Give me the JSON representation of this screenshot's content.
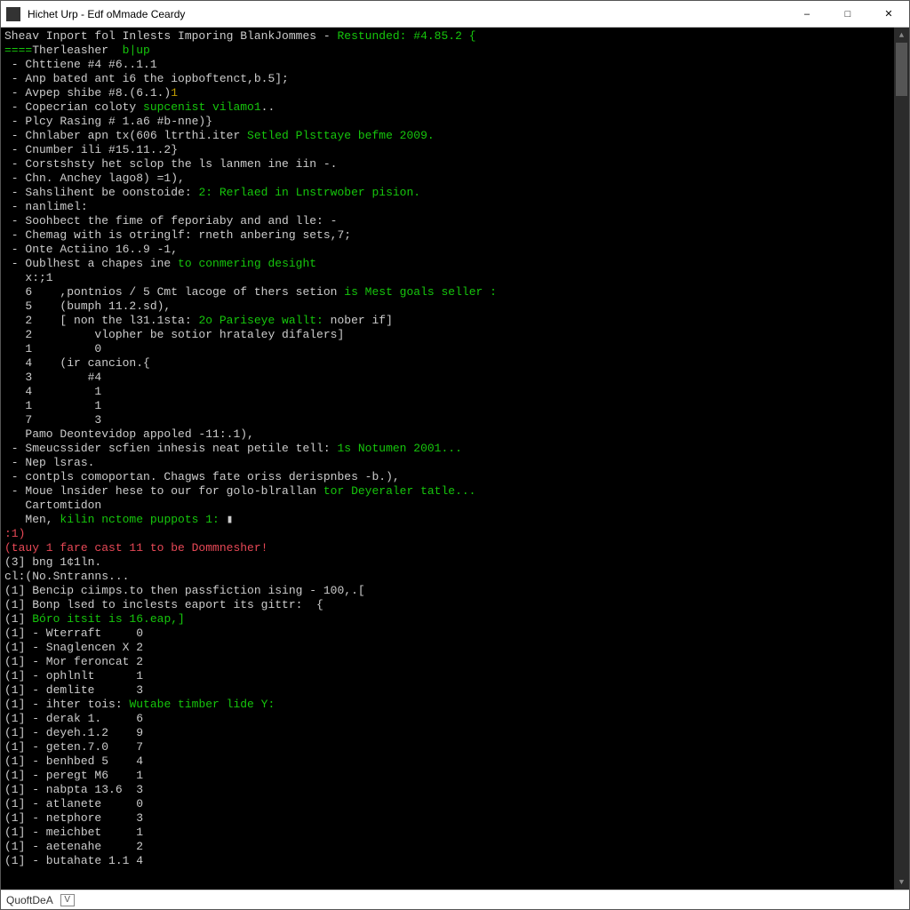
{
  "window": {
    "title": "Hichet Urp - Edf oMmade Ceardy"
  },
  "statusbar": {
    "label": "QuoftDeA",
    "box": "V"
  },
  "lines": [
    [
      {
        "t": "Sheav Inport fol Inlests Imporing BlankJommes - ",
        "c": "w"
      },
      {
        "t": "Restunded: #4.85.2 {",
        "c": "g"
      }
    ],
    [
      {
        "t": "====",
        "c": "g"
      },
      {
        "t": "Therleasher  ",
        "c": "w"
      },
      {
        "t": "b|up",
        "c": "g"
      }
    ],
    [
      {
        "t": " - Chttiene #4 #6..1.1",
        "c": "w"
      }
    ],
    [
      {
        "t": " - Anp bated ant i6 the iopboftenct,b.5];",
        "c": "w"
      }
    ],
    [
      {
        "t": " - Avpep shibe #8.(6.1.)",
        "c": "w"
      },
      {
        "t": "1",
        "c": "y"
      }
    ],
    [
      {
        "t": " - Copecrian coloty ",
        "c": "w"
      },
      {
        "t": "supcenist vilamo1",
        "c": "g"
      },
      {
        "t": "..",
        "c": "w"
      }
    ],
    [
      {
        "t": " - Plcy Rasing # 1.a6 #b-nne)}",
        "c": "w"
      }
    ],
    [
      {
        "t": " - Chnlaber apn tx(606 ltrthi.iter ",
        "c": "w"
      },
      {
        "t": "Setled Plsttaye befme 2009.",
        "c": "g"
      }
    ],
    [
      {
        "t": " - Cnumber ili #15.11..2}",
        "c": "w"
      }
    ],
    [
      {
        "t": " - Corstshsty het sclop the ls lanmen ine iin -.",
        "c": "w"
      }
    ],
    [
      {
        "t": " - Chn. Anchey lago8) =1),",
        "c": "w"
      }
    ],
    [
      {
        "t": " - Sahslihent be oonstoide: ",
        "c": "w"
      },
      {
        "t": "2: Rerlaed in Lnstrwober pision.",
        "c": "g"
      }
    ],
    [
      {
        "t": " - nanlimel:",
        "c": "w"
      }
    ],
    [
      {
        "t": " - Soohbect the fime of feporiaby and and lle: -",
        "c": "w"
      }
    ],
    [
      {
        "t": " - Chemag with is otringlf: rneth anbering sets,7;",
        "c": "w"
      }
    ],
    [
      {
        "t": " - Onte Actiino 16..9 -1,",
        "c": "w"
      }
    ],
    [
      {
        "t": " - Oublhest a chapes ine ",
        "c": "w"
      },
      {
        "t": "to conmering desight",
        "c": "g"
      }
    ],
    [
      {
        "t": "   x:;1",
        "c": "w"
      }
    ],
    [
      {
        "t": "   6    ,pontnios / 5 Cmt lacoge of thers setion ",
        "c": "w"
      },
      {
        "t": "is Mest goals seller :",
        "c": "g"
      }
    ],
    [
      {
        "t": "   5    (bumph 11.2.sd),",
        "c": "w"
      }
    ],
    [
      {
        "t": "   2    [ non the l31.1sta: ",
        "c": "w"
      },
      {
        "t": "2o Pariseye wallt:",
        "c": "g"
      },
      {
        "t": " nober if]",
        "c": "w"
      }
    ],
    [
      {
        "t": "   2         vlopher be sotior hrataley difalers]",
        "c": "w"
      }
    ],
    [
      {
        "t": "   1         0",
        "c": "w"
      }
    ],
    [
      {
        "t": "   4    (ir cancion.{",
        "c": "w"
      }
    ],
    [
      {
        "t": "   3        #4",
        "c": "w"
      }
    ],
    [
      {
        "t": "   4         1",
        "c": "w"
      }
    ],
    [
      {
        "t": "   1         1",
        "c": "w"
      }
    ],
    [
      {
        "t": "   7         3",
        "c": "w"
      }
    ],
    [
      {
        "t": "   Pamo Deontevidop appoled -11:.1),",
        "c": "w"
      }
    ],
    [
      {
        "t": " - Smeucssider scfien inhesis neat petile tell: ",
        "c": "w"
      },
      {
        "t": "1s Notumen 2001...",
        "c": "g"
      }
    ],
    [
      {
        "t": " - Nep lsras.",
        "c": "w"
      }
    ],
    [
      {
        "t": " - contpls comoportan. Chagws fate oriss derispnbes -b.),",
        "c": "w"
      }
    ],
    [
      {
        "t": " - Moue lnsider hese to our for golo-blrallan ",
        "c": "w"
      },
      {
        "t": "tor Deyeraler tatle...",
        "c": "g"
      }
    ],
    [
      {
        "t": "   Cartomtidon",
        "c": "w"
      }
    ],
    [
      {
        "t": "   Men, ",
        "c": "w"
      },
      {
        "t": "kilin nctome puppots 1: ",
        "c": "g"
      },
      {
        "t": "▮",
        "c": "w"
      }
    ],
    [
      {
        "t": ":1)",
        "c": "r"
      }
    ],
    [
      {
        "t": "(tauy 1 fare cast 11 to be Dommnesher!",
        "c": "r"
      }
    ],
    [
      {
        "t": "(3] bng 1¢1ln.",
        "c": "w"
      }
    ],
    [
      {
        "t": "cl:(No.Sntranns...",
        "c": "w"
      }
    ],
    [
      {
        "t": "(1] Bencip ciimps.to then passfiction ising - 100,.[",
        "c": "w"
      }
    ],
    [
      {
        "t": "(1] Bonp lsed to inclests eaport its gittr:  {",
        "c": "w"
      }
    ],
    [
      {
        "t": "(1] ",
        "c": "w"
      },
      {
        "t": "Bóro itsit is 16.eap,]",
        "c": "g"
      }
    ],
    [
      {
        "t": "(1] - Wterraft     0",
        "c": "w"
      }
    ],
    [
      {
        "t": "(1] - Snaglencen X 2",
        "c": "w"
      }
    ],
    [
      {
        "t": "(1] - Mor feroncat 2",
        "c": "w"
      }
    ],
    [
      {
        "t": "(1] - ophlnlt      1",
        "c": "w"
      }
    ],
    [
      {
        "t": "(1] - demlite      3",
        "c": "w"
      }
    ],
    [
      {
        "t": "(1] - ihter tois: ",
        "c": "w"
      },
      {
        "t": "Wutabe timber lide Y:",
        "c": "g"
      }
    ],
    [
      {
        "t": "(1] - derak 1.     6",
        "c": "w"
      }
    ],
    [
      {
        "t": "(1] - deyeh.1.2    9",
        "c": "w"
      }
    ],
    [
      {
        "t": "(1] - geten.7.0    7",
        "c": "w"
      }
    ],
    [
      {
        "t": "(1] - benhbed 5    4",
        "c": "w"
      }
    ],
    [
      {
        "t": "(1] - peregt M6    1",
        "c": "w"
      }
    ],
    [
      {
        "t": "(1] - nabpta 13.6  3",
        "c": "w"
      }
    ],
    [
      {
        "t": "(1] - atlanete     0",
        "c": "w"
      }
    ],
    [
      {
        "t": "(1] - netphore     3",
        "c": "w"
      }
    ],
    [
      {
        "t": "(1] - meichbet     1",
        "c": "w"
      }
    ],
    [
      {
        "t": "(1] - aetenahe     2",
        "c": "w"
      }
    ],
    [
      {
        "t": "(1] - butahate 1.1 4",
        "c": "w"
      }
    ]
  ]
}
